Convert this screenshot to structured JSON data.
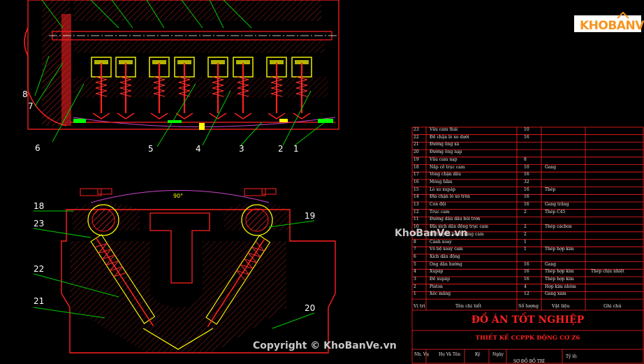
{
  "logo": {
    "text": "KHOBANVE"
  },
  "watermark": {
    "mid": "KhoBanVe.vn",
    "bottom": "Copyright © KhoBanVe.vn"
  },
  "part_labels_top": [
    "8",
    "7",
    "6",
    "5",
    "4",
    "3",
    "2",
    "1"
  ],
  "part_labels_bottom": [
    "18",
    "23",
    "22",
    "21",
    "19",
    "20"
  ],
  "angle_label": "90°",
  "bom": {
    "rows": [
      {
        "no": "23",
        "name": "Vấu cam thải",
        "qty": "10",
        "mat": "",
        "note": ""
      },
      {
        "no": "22",
        "name": "Đế chặn lò xo dưới",
        "qty": "16",
        "mat": "",
        "note": ""
      },
      {
        "no": "21",
        "name": "Đường ống xả",
        "qty": "",
        "mat": "",
        "note": ""
      },
      {
        "no": "20",
        "name": "Đường ống nạp",
        "qty": "",
        "mat": "",
        "note": ""
      },
      {
        "no": "19",
        "name": "Vấu cam nạp",
        "qty": "8",
        "mat": "",
        "note": ""
      },
      {
        "no": "18",
        "name": "Nắp cổ trục cam",
        "qty": "10",
        "mat": "Gang",
        "note": ""
      },
      {
        "no": "17",
        "name": "Vòng chặn dầu",
        "qty": "16",
        "mat": "",
        "note": ""
      },
      {
        "no": "16",
        "name": "Móng hãm",
        "qty": "32",
        "mat": "",
        "note": ""
      },
      {
        "no": "15",
        "name": "Lò xo xupáp",
        "qty": "16",
        "mat": "Thép",
        "note": ""
      },
      {
        "no": "14",
        "name": "Đĩa chặn lò xo trên",
        "qty": "16",
        "mat": "",
        "note": ""
      },
      {
        "no": "13",
        "name": "Con đội",
        "qty": "16",
        "mat": "Gang trắng",
        "note": ""
      },
      {
        "no": "12",
        "name": "Trục cam",
        "qty": "2",
        "mat": "Thép C45",
        "note": ""
      },
      {
        "no": "11",
        "name": "Đường dẫn dầu bôi trơn",
        "qty": "",
        "mat": "",
        "note": ""
      },
      {
        "no": "10",
        "name": "Đĩa xích dẫn động trục cam",
        "qty": "2",
        "mat": "Thép cácbon",
        "note": ""
      },
      {
        "no": "9",
        "name": "Bộ truyền bánh răng cam",
        "qty": "2",
        "mat": "",
        "note": ""
      },
      {
        "no": "8",
        "name": "Cánh xoay",
        "qty": "1",
        "mat": "",
        "note": ""
      },
      {
        "no": "7",
        "name": "Vỏ bộ xoay cam",
        "qty": "1",
        "mat": "Thép hợp kim",
        "note": ""
      },
      {
        "no": "6",
        "name": "Xích dẫn động",
        "qty": "",
        "mat": "",
        "note": ""
      },
      {
        "no": "5",
        "name": "Ống dẫn hướng",
        "qty": "16",
        "mat": "Gang",
        "note": ""
      },
      {
        "no": "4",
        "name": "Xupáp",
        "qty": "16",
        "mat": "Thép hợp kim",
        "note": "Thép chịu nhiệt"
      },
      {
        "no": "3",
        "name": "Đế xupáp",
        "qty": "16",
        "mat": "Thép hợp kim",
        "note": ""
      },
      {
        "no": "2",
        "name": "Piston",
        "qty": "4",
        "mat": "Hợp kim nhôm",
        "note": ""
      },
      {
        "no": "1",
        "name": "Xéc măng",
        "qty": "12",
        "mat": "Gang xám",
        "note": ""
      }
    ],
    "header": {
      "no": "Vị trí",
      "name": "Tên chi tiết",
      "qty": "Số lượng",
      "mat": "Vật liệu",
      "note": "Ghi chú"
    }
  },
  "title": {
    "main": "ĐỒ ÁN TỐT NGHIỆP",
    "sub": "THIẾT KẾ CCPPK ĐỘNG CƠ Z6"
  },
  "signature": {
    "a": "Nh. Vụ",
    "b": "Họ Và Tên",
    "c": "Ký",
    "d": "Ngày",
    "e": "SƠ ĐỒ BỐ TRÍ",
    "f": "Tỷ lệ:"
  },
  "colors": {
    "bg": "#000000",
    "line": "#ff2020",
    "hatch": "#ff3333",
    "yellow": "#ffff00",
    "green": "#00ff00",
    "leader": "#00cc00",
    "arc": "#cc44cc"
  }
}
